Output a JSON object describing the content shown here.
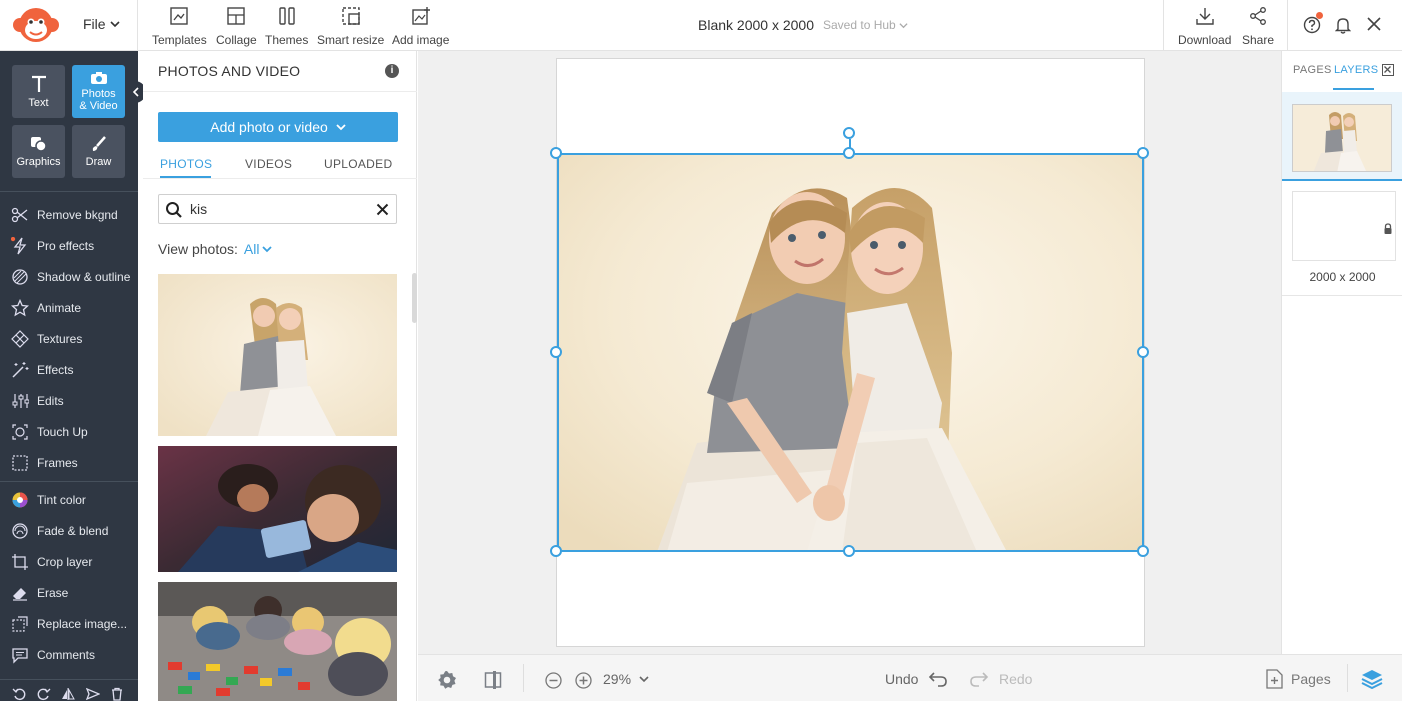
{
  "topbar": {
    "file_label": "File",
    "tools": [
      {
        "label": "Templates",
        "icon": "templates-icon"
      },
      {
        "label": "Collage",
        "icon": "collage-icon"
      },
      {
        "label": "Themes",
        "icon": "themes-icon"
      },
      {
        "label": "Smart resize",
        "icon": "smart-resize-icon"
      },
      {
        "label": "Add image",
        "icon": "add-image-icon"
      }
    ],
    "doc_title": "Blank 2000 x 2000",
    "save_status": "Saved to Hub",
    "download_label": "Download",
    "share_label": "Share"
  },
  "rail": {
    "big_tools": [
      {
        "label": "Text",
        "active": false
      },
      {
        "label": "Photos & Video",
        "active": true
      },
      {
        "label": "Graphics",
        "active": false
      },
      {
        "label": "Draw",
        "active": false
      }
    ],
    "items": [
      {
        "label": "Remove bkgnd",
        "icon": "scissors-icon"
      },
      {
        "label": "Pro effects",
        "icon": "lightning-icon"
      },
      {
        "label": "Shadow & outline",
        "icon": "shadow-icon"
      },
      {
        "label": "Animate",
        "icon": "star-icon"
      },
      {
        "label": "Textures",
        "icon": "textures-icon"
      },
      {
        "label": "Effects",
        "icon": "magic-wand-icon"
      },
      {
        "label": "Edits",
        "icon": "sliders-icon"
      },
      {
        "label": "Touch Up",
        "icon": "face-icon"
      },
      {
        "label": "Frames",
        "icon": "frame-icon"
      },
      {
        "label": "Tint color",
        "icon": "color-wheel-icon"
      },
      {
        "label": "Fade & blend",
        "icon": "fade-icon"
      },
      {
        "label": "Crop layer",
        "icon": "crop-icon"
      },
      {
        "label": "Erase",
        "icon": "eraser-icon"
      },
      {
        "label": "Replace image...",
        "icon": "replace-icon"
      },
      {
        "label": "Comments",
        "icon": "comment-icon"
      }
    ]
  },
  "panel": {
    "title": "PHOTOS AND VIDEO",
    "add_button": "Add photo or video",
    "tabs": [
      "PHOTOS",
      "VIDEOS",
      "UPLOADED"
    ],
    "active_tab": "PHOTOS",
    "search_value": "kis",
    "view_label": "View photos:",
    "view_value": "All"
  },
  "bottombar": {
    "zoom": "29%",
    "undo": "Undo",
    "redo": "Redo",
    "pages": "Pages"
  },
  "rpanel": {
    "tabs": [
      "PAGES",
      "LAYERS"
    ],
    "active_tab": "LAYERS",
    "layer2_label": "2000 x 2000"
  },
  "colors": {
    "accent": "#3aa0df",
    "rail_bg": "#2f3743",
    "logo": "#f0633d"
  }
}
